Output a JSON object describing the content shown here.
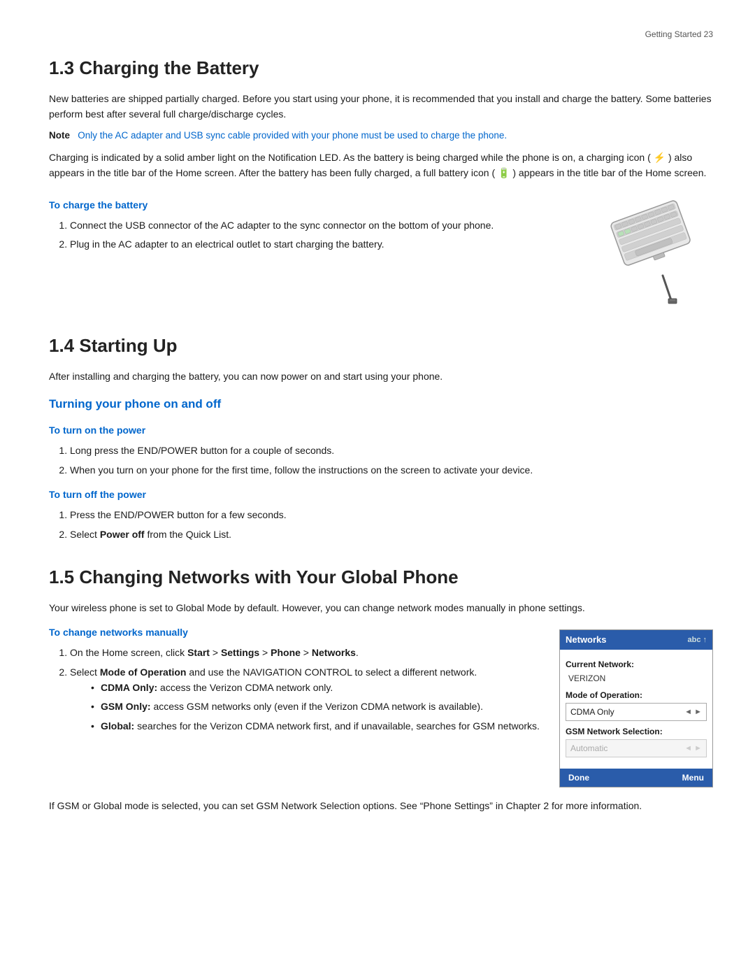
{
  "page": {
    "header": "Getting Started  23",
    "sections": [
      {
        "id": "1.3",
        "title": "1.3  Charging the Battery",
        "body_paragraphs": [
          "New batteries are shipped partially charged. Before you start using your phone, it is recommended that you install and charge the battery. Some batteries perform best after several full charge/discharge cycles.",
          "Charging is indicated by a solid amber light on the Notification LED. As the battery is being charged while the phone is on, a charging icon ( ⚡ ) also appears in the title bar of the Home screen. After the battery has been fully charged, a full battery icon ( 🔋 ) appears in the title bar of the Home screen."
        ],
        "note": {
          "label": "Note",
          "text": "Only the AC adapter and USB sync cable provided with your phone must be used to charge the phone."
        },
        "procedure": {
          "title": "To charge the battery",
          "steps": [
            "Connect the USB connector of the AC adapter to the sync connector on the bottom of your phone.",
            "Plug in the AC adapter to an electrical outlet to start charging the battery."
          ]
        }
      },
      {
        "id": "1.4",
        "title": "1.4  Starting Up",
        "intro": "After installing and charging the battery, you can now power on and start using your phone.",
        "subsections": [
          {
            "title": "Turning your phone on and off",
            "procedures": [
              {
                "title": "To turn on the power",
                "steps": [
                  "Long press the END/POWER button for a couple of seconds.",
                  "When you turn on your phone for the first time, follow the instructions on the screen to activate your device."
                ]
              },
              {
                "title": "To turn off the power",
                "steps": [
                  "Press the END/POWER button for a few seconds.",
                  "Select Power off from the Quick List."
                ]
              }
            ]
          }
        ]
      },
      {
        "id": "1.5",
        "title": "1.5  Changing Networks with Your Global Phone",
        "intro": "Your wireless phone is set to Global Mode by default. However, you can change network modes manually in phone settings.",
        "procedure": {
          "title": "To change networks manually",
          "steps": [
            {
              "text": "On the Home screen, click Start > Settings > Phone > Networks.",
              "bold_segments": [
                "Start",
                "Settings",
                "Phone",
                "Networks"
              ]
            },
            {
              "text": "Select Mode of Operation and use the NAVIGATION CONTROL to select a different network.",
              "bold_segments": [
                "Mode of Operation"
              ],
              "bullets": [
                {
                  "label": "CDMA Only:",
                  "text": "access the Verizon CDMA network only."
                },
                {
                  "label": "GSM Only:",
                  "text": "access GSM networks only (even if the Verizon CDMA network is available)."
                },
                {
                  "label": "Global:",
                  "text": "searches for the Verizon CDMA network first, and if unavailable, searches for GSM networks."
                }
              ]
            }
          ]
        },
        "networks_ui": {
          "header_title": "Networks",
          "header_right": "abc ↑",
          "current_network_label": "Current Network:",
          "current_network_value": "VERIZON",
          "mode_label": "Mode of Operation:",
          "mode_value": "CDMA Only",
          "gsm_label": "GSM Network Selection:",
          "gsm_value": "Automatic",
          "footer_left": "Done",
          "footer_right": "Menu"
        },
        "footer_text": "If GSM or Global mode is selected, you can set GSM Network Selection options. See “Phone Settings” in Chapter 2 for more information."
      }
    ]
  }
}
